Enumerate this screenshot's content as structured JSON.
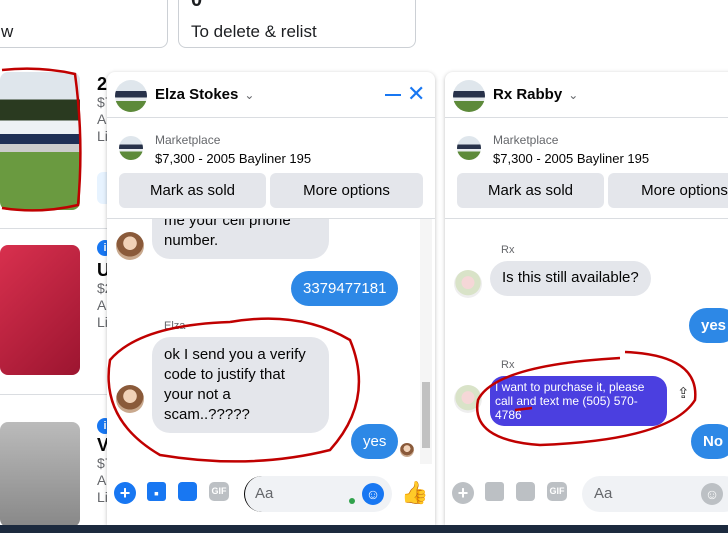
{
  "stats": {
    "card1_text": "w",
    "card2_count": "0",
    "card2_label": "To delete & relist"
  },
  "listings": [
    {
      "title": "2",
      "price": "$7",
      "line3": "Ac",
      "line4": "Li"
    },
    {
      "title": "U",
      "price": "$2",
      "line3": "Ac",
      "line4": "Li"
    },
    {
      "title": "V",
      "price": "$7",
      "line3": "Ac",
      "line4": "Li"
    }
  ],
  "chat1": {
    "name": "Elza Stokes",
    "chevron": "⌄",
    "source": "Marketplace",
    "item": "$7,300 - 2005 Bayliner 195",
    "mark_sold": "Mark as sold",
    "more_options": "More options",
    "messages": [
      {
        "from": "in",
        "text": "me your cell phone number."
      },
      {
        "from": "out",
        "text": "3379477181"
      },
      {
        "from": "in",
        "sender": "Elza",
        "text": "ok I send you a verify code to justify that your not a scam..?????"
      },
      {
        "from": "out",
        "text": "yes"
      }
    ],
    "input_placeholder": "Aa"
  },
  "chat2": {
    "name": "Rx Rabby",
    "chevron": "⌄",
    "source": "Marketplace",
    "item": "$7,300 - 2005 Bayliner 195",
    "mark_sold": "Mark as sold",
    "more_options": "More options",
    "messages": [
      {
        "from": "in",
        "sender": "Rx",
        "text": "Is this still available?"
      },
      {
        "from": "out",
        "text": "yes"
      },
      {
        "from": "in",
        "sender": "Rx",
        "text": "I want to purchase it, please call and text me (505) 570-4786"
      },
      {
        "from": "out",
        "text": "No"
      }
    ],
    "input_placeholder": "Aa"
  },
  "colors": {
    "accent": "#1877f2",
    "bubble_out": "#2d88e6",
    "bubble_highlight": "#4b3fe0",
    "annotation": "#c00000",
    "taskbar": "#1c2a3e"
  }
}
